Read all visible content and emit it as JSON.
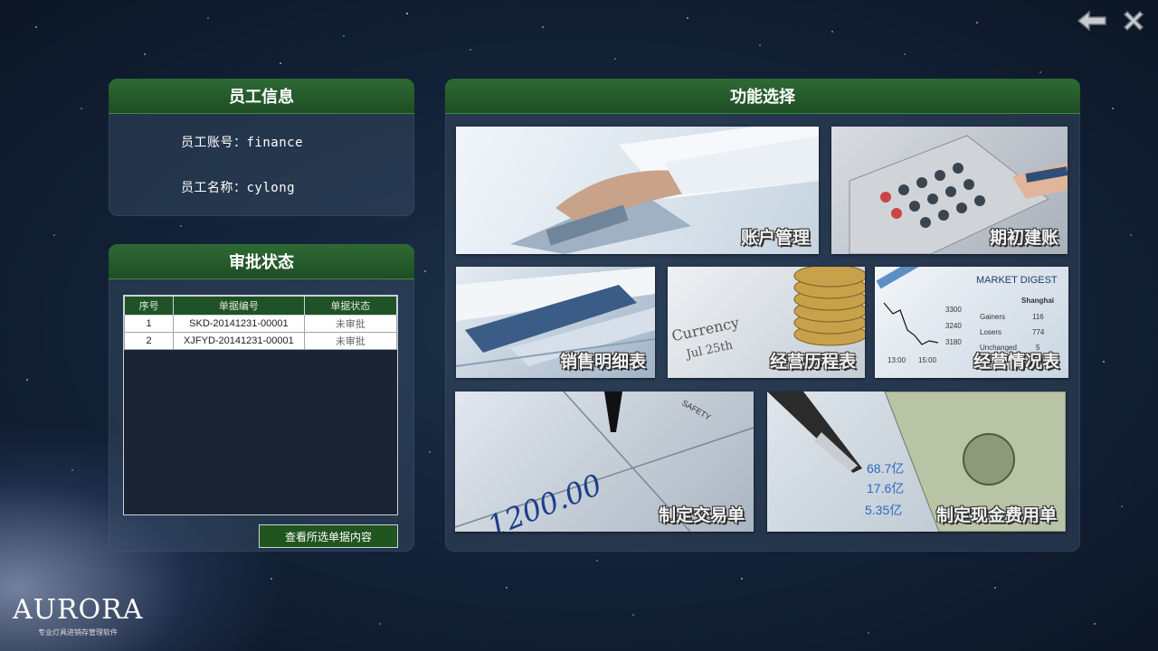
{
  "window": {
    "back_icon": "back-arrow-icon",
    "close_icon": "close-icon"
  },
  "employee": {
    "title": "员工信息",
    "account_label": "员工账号：finance",
    "name_label": "员工名称：cylong"
  },
  "approval": {
    "title": "审批状态",
    "columns": [
      "序号",
      "单据编号",
      "单据状态"
    ],
    "rows": [
      {
        "no": "1",
        "code": "SKD-20141231-00001",
        "status": "未审批"
      },
      {
        "no": "2",
        "code": "XJFYD-20141231-00001",
        "status": "未审批"
      }
    ],
    "view_button": "查看所选单据内容"
  },
  "functions": {
    "title": "功能选择",
    "tiles": [
      {
        "label": "账户管理"
      },
      {
        "label": "期初建账"
      },
      {
        "label": "销售明细表"
      },
      {
        "label": "经营历程表"
      },
      {
        "label": "经营情况表"
      },
      {
        "label": "制定交易单"
      },
      {
        "label": "制定现金费用单"
      }
    ]
  },
  "tile_art": {
    "currency_text": "Currency",
    "date_text": "Jul 25th",
    "market_title": "MARKET DIGEST",
    "market_city": "Shanghai",
    "market_rows": [
      {
        "k": "Gainers",
        "v": "116"
      },
      {
        "k": "Losers",
        "v": "774"
      },
      {
        "k": "Unchanged",
        "v": "5"
      }
    ],
    "ticks_y": [
      "3300",
      "3240",
      "3180"
    ],
    "ticks_x": [
      "13:00",
      "15:00"
    ],
    "check_amount": "1200.00",
    "ledger_values": [
      "68.7亿",
      "17.6亿",
      "5.35亿"
    ],
    "safety_text": "SAFETY"
  },
  "brand": {
    "logo": "AURORA",
    "tagline": "专业灯具进销存管理软件"
  },
  "colors": {
    "header_green": "#2e6a34",
    "button_green": "#21551f"
  }
}
